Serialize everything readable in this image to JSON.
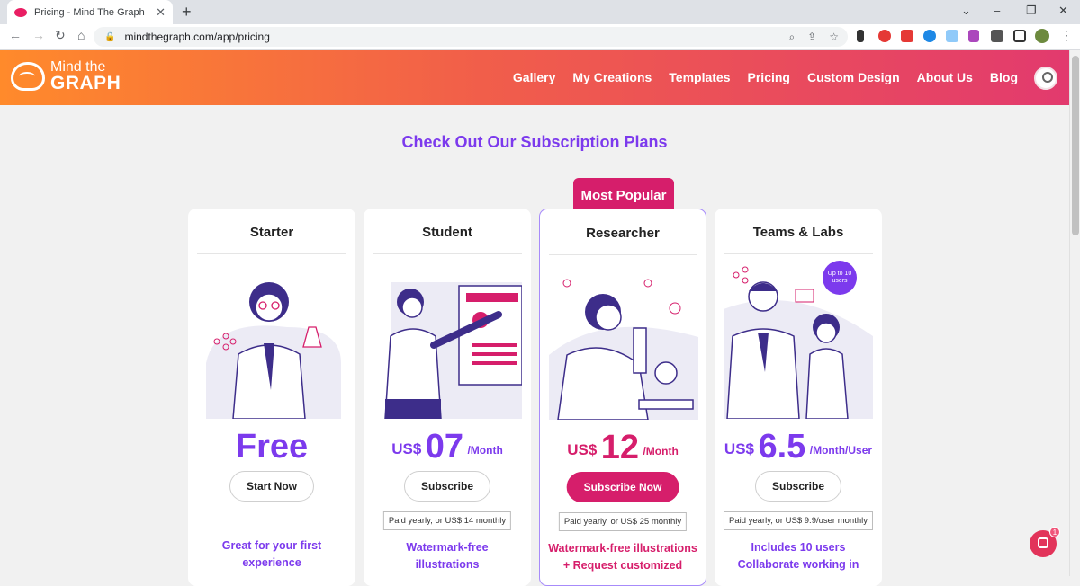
{
  "browser": {
    "tab_title": "Pricing - Mind The Graph",
    "url": "mindthegraph.com/app/pricing"
  },
  "header": {
    "logo_line1": "Mind the",
    "logo_line2": "GRAPH",
    "menu": [
      "Gallery",
      "My Creations",
      "Templates",
      "Pricing",
      "Custom Design",
      "About Us",
      "Blog"
    ]
  },
  "page": {
    "heading": "Check Out Our Subscription Plans",
    "badge": "Most Popular"
  },
  "plans": [
    {
      "title": "Starter",
      "price_currency": "",
      "price_value": "Free",
      "price_period": "",
      "button": "Start Now",
      "note": "",
      "features": "Great for your first experience"
    },
    {
      "title": "Student",
      "price_currency": "US$",
      "price_value": "07",
      "price_period": "/Month",
      "button": "Subscribe",
      "note": "Paid yearly, or US$ 14 monthly",
      "features": "Watermark-free illustrations"
    },
    {
      "title": "Researcher",
      "price_currency": "US$",
      "price_value": "12",
      "price_period": "/Month",
      "button": "Subscribe Now",
      "note": "Paid yearly, or US$ 25 monthly",
      "features": "Watermark-free illustrations + Request customized"
    },
    {
      "title": "Teams & Labs",
      "price_currency": "US$",
      "price_value": "6.5",
      "price_period": "/Month/User",
      "button": "Subscribe",
      "note": "Paid yearly, or US$ 9.9/user monthly",
      "features": "Includes 10 users Collaborate working in"
    }
  ],
  "teams_badge": "Up to 10 users",
  "chat_count": "1",
  "colors": {
    "accent_purple": "#7c3aed",
    "accent_pink": "#d61e6b",
    "header_gradient_start": "#ff8a2b",
    "header_gradient_end": "#e23a6e"
  }
}
